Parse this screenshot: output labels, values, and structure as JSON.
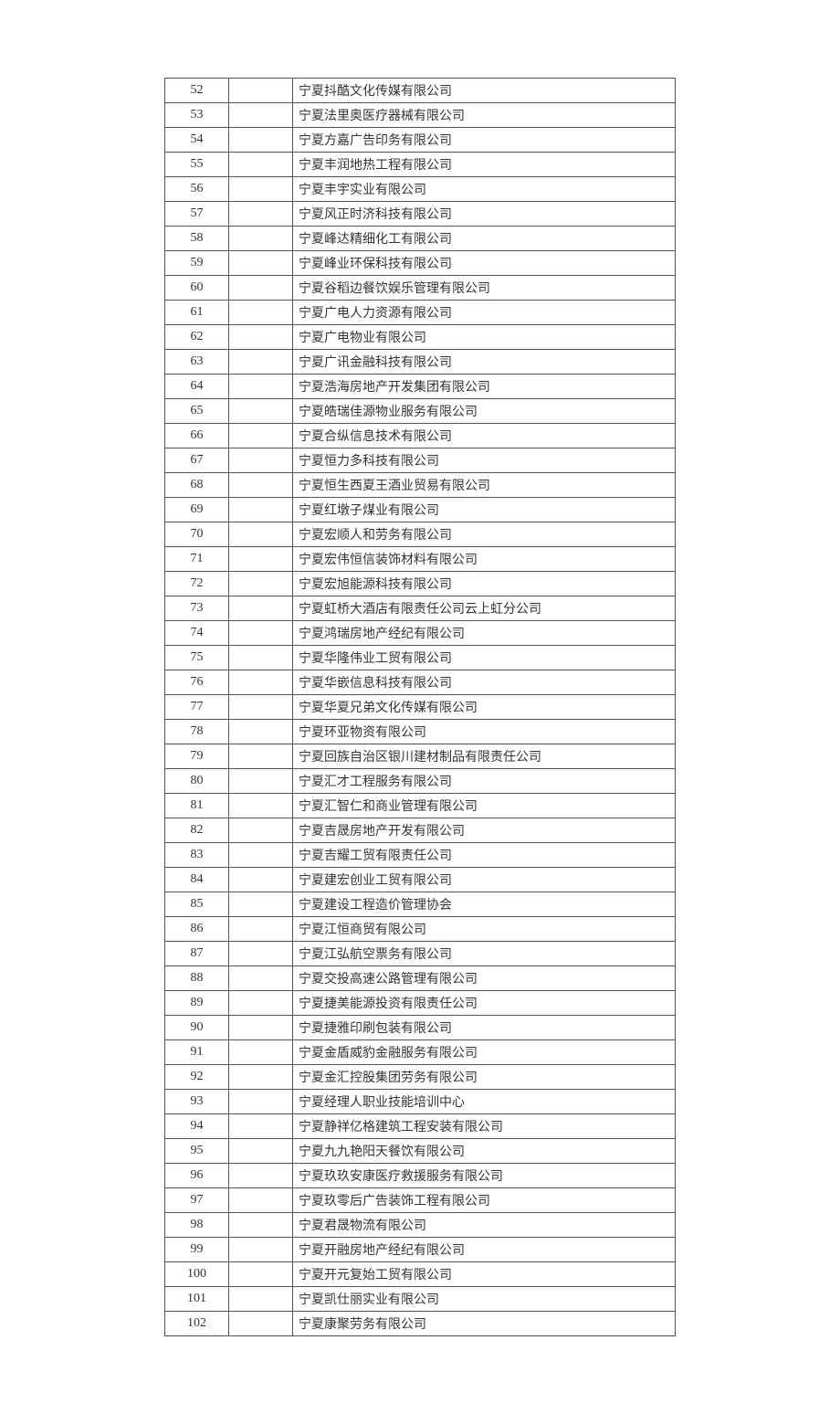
{
  "rows": [
    {
      "idx": "52",
      "name": "宁夏抖酷文化传媒有限公司"
    },
    {
      "idx": "53",
      "name": "宁夏法里奥医疗器械有限公司"
    },
    {
      "idx": "54",
      "name": "宁夏方嘉广告印务有限公司"
    },
    {
      "idx": "55",
      "name": "宁夏丰润地热工程有限公司"
    },
    {
      "idx": "56",
      "name": "宁夏丰宇实业有限公司"
    },
    {
      "idx": "57",
      "name": "宁夏风正时济科技有限公司"
    },
    {
      "idx": "58",
      "name": "宁夏峰达精细化工有限公司"
    },
    {
      "idx": "59",
      "name": "宁夏峰业环保科技有限公司"
    },
    {
      "idx": "60",
      "name": "宁夏谷稻边餐饮娱乐管理有限公司"
    },
    {
      "idx": "61",
      "name": "宁夏广电人力资源有限公司"
    },
    {
      "idx": "62",
      "name": "宁夏广电物业有限公司"
    },
    {
      "idx": "63",
      "name": "宁夏广讯金融科技有限公司"
    },
    {
      "idx": "64",
      "name": "宁夏浩海房地产开发集团有限公司"
    },
    {
      "idx": "65",
      "name": "宁夏皓瑞佳源物业服务有限公司"
    },
    {
      "idx": "66",
      "name": "宁夏合纵信息技术有限公司"
    },
    {
      "idx": "67",
      "name": "宁夏恒力多科技有限公司"
    },
    {
      "idx": "68",
      "name": "宁夏恒生西夏王酒业贸易有限公司"
    },
    {
      "idx": "69",
      "name": "宁夏红墩子煤业有限公司"
    },
    {
      "idx": "70",
      "name": "宁夏宏顺人和劳务有限公司"
    },
    {
      "idx": "71",
      "name": "宁夏宏伟恒信装饰材料有限公司"
    },
    {
      "idx": "72",
      "name": "宁夏宏旭能源科技有限公司"
    },
    {
      "idx": "73",
      "name": "宁夏虹桥大酒店有限责任公司云上虹分公司"
    },
    {
      "idx": "74",
      "name": "宁夏鸿瑞房地产经纪有限公司"
    },
    {
      "idx": "75",
      "name": "宁夏华隆伟业工贸有限公司"
    },
    {
      "idx": "76",
      "name": "宁夏华嵌信息科技有限公司"
    },
    {
      "idx": "77",
      "name": "宁夏华夏兄弟文化传媒有限公司"
    },
    {
      "idx": "78",
      "name": "宁夏环亚物资有限公司"
    },
    {
      "idx": "79",
      "name": "宁夏回族自治区银川建材制品有限责任公司"
    },
    {
      "idx": "80",
      "name": "宁夏汇才工程服务有限公司"
    },
    {
      "idx": "81",
      "name": "宁夏汇智仁和商业管理有限公司"
    },
    {
      "idx": "82",
      "name": "宁夏吉晟房地产开发有限公司"
    },
    {
      "idx": "83",
      "name": "宁夏吉耀工贸有限责任公司"
    },
    {
      "idx": "84",
      "name": "宁夏建宏创业工贸有限公司"
    },
    {
      "idx": "85",
      "name": "宁夏建设工程造价管理协会"
    },
    {
      "idx": "86",
      "name": "宁夏江恒商贸有限公司"
    },
    {
      "idx": "87",
      "name": "宁夏江弘航空票务有限公司"
    },
    {
      "idx": "88",
      "name": "宁夏交投高速公路管理有限公司"
    },
    {
      "idx": "89",
      "name": "宁夏捷美能源投资有限责任公司"
    },
    {
      "idx": "90",
      "name": "宁夏捷雅印刷包装有限公司"
    },
    {
      "idx": "91",
      "name": "宁夏金盾威豹金融服务有限公司"
    },
    {
      "idx": "92",
      "name": "宁夏金汇控股集团劳务有限公司"
    },
    {
      "idx": "93",
      "name": "宁夏经理人职业技能培训中心"
    },
    {
      "idx": "94",
      "name": "宁夏静祥亿格建筑工程安装有限公司"
    },
    {
      "idx": "95",
      "name": "宁夏九九艳阳天餐饮有限公司"
    },
    {
      "idx": "96",
      "name": "宁夏玖玖安康医疗救援服务有限公司"
    },
    {
      "idx": "97",
      "name": "宁夏玖零后广告装饰工程有限公司"
    },
    {
      "idx": "98",
      "name": "宁夏君晟物流有限公司"
    },
    {
      "idx": "99",
      "name": "宁夏开融房地产经纪有限公司"
    },
    {
      "idx": "100",
      "name": "宁夏开元复始工贸有限公司"
    },
    {
      "idx": "101",
      "name": "宁夏凯仕丽实业有限公司"
    },
    {
      "idx": "102",
      "name": "宁夏康聚劳务有限公司"
    }
  ]
}
